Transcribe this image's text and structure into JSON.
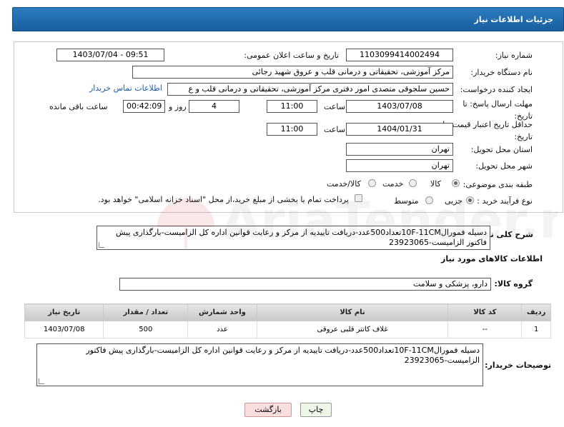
{
  "header": {
    "title": "جزئیات اطلاعات نیاز"
  },
  "form": {
    "need_number_label": "شماره نیاز:",
    "need_number": "1103099414002494",
    "announce_label": "تاریخ و ساعت اعلان عمومی:",
    "announce_value": "1403/07/04 - 09:51",
    "buyer_org_label": "نام دستگاه خریدار:",
    "buyer_org": "مرکز آموزشی، تحقیقاتی و درمانی قلب و عروق شهید رجائی",
    "creator_label": "ایجاد کننده درخواست:",
    "creator": "حسین سلجوقی متصدی امور دفتری مرکز آموزشی، تحقیقاتی و درمانی قلب و ع",
    "contact_link": "اطلاعات تماس خریدار",
    "deadline_label": "مهلت ارسال پاسخ: تا تاریخ:",
    "deadline_date": "1403/07/08",
    "time_label": "ساعت",
    "deadline_time": "11:00",
    "days_value": "4",
    "days_label": "روز و",
    "remaining_time": "00:42:09",
    "remaining_label": "ساعت باقی مانده",
    "validity_label": "حداقل تاریخ اعتبار قیمت: تا تاریخ:",
    "validity_date": "1404/01/31",
    "validity_time": "11:00",
    "province_label": "استان محل تحویل:",
    "province": "تهران",
    "city_label": "شهر محل تحویل:",
    "city": "تهران",
    "category_label": "طبقه بندی موضوعی:",
    "category_options": [
      "کالا",
      "خدمت",
      "کالا/خدمت"
    ],
    "process_label": "نوع فرآیند خرید :",
    "process_options": [
      "جزیی",
      "متوسط"
    ],
    "payment_note": "پرداخت تمام یا بخشی از مبلغ خرید،از محل \"اسناد خزانه اسلامی\" خواهد بود."
  },
  "description": {
    "label": "شرح کلی نیاز:",
    "text": "دسیله فمورال10F-11CMتعداد500عدد-دریافت تاییدیه از مرکز و رعایت قوانین اداره کل الزامیست-بارگذاری پیش فاکتور الزامیست-23923065"
  },
  "goods": {
    "section_title": "اطلاعات کالاهای مورد نیاز",
    "group_label": "گروه کالا:",
    "group_value": "دارو، پزشکی و سلامت",
    "columns": [
      "ردیف",
      "کد کالا",
      "نام کالا",
      "واحد شمارش",
      "تعداد / مقدار",
      "تاریخ نیاز"
    ],
    "rows": [
      {
        "row": "1",
        "code": "--",
        "name": "غلاف کاتتر قلبی عروقی",
        "unit": "عدد",
        "qty": "500",
        "date": "1403/07/08"
      }
    ]
  },
  "buyer_notes": {
    "label": "توضیحات خریدار:",
    "text": "دسیله فمورال10F-11CMتعداد500عدد-دریافت تاییدیه از مرکز و رعایت قوانین اداره کل الزامیست-بارگذاری پیش فاکتور الزامیست-23923065"
  },
  "buttons": {
    "print": "چاپ",
    "back": "بازگشت"
  },
  "watermark": {
    "brand": "AriaTender.neT"
  },
  "colors": {
    "title_bg": "#185f9e",
    "back_button_bg": "#f8dede",
    "print_button_bg": "#eef6e8",
    "link": "#1a5fb4"
  }
}
